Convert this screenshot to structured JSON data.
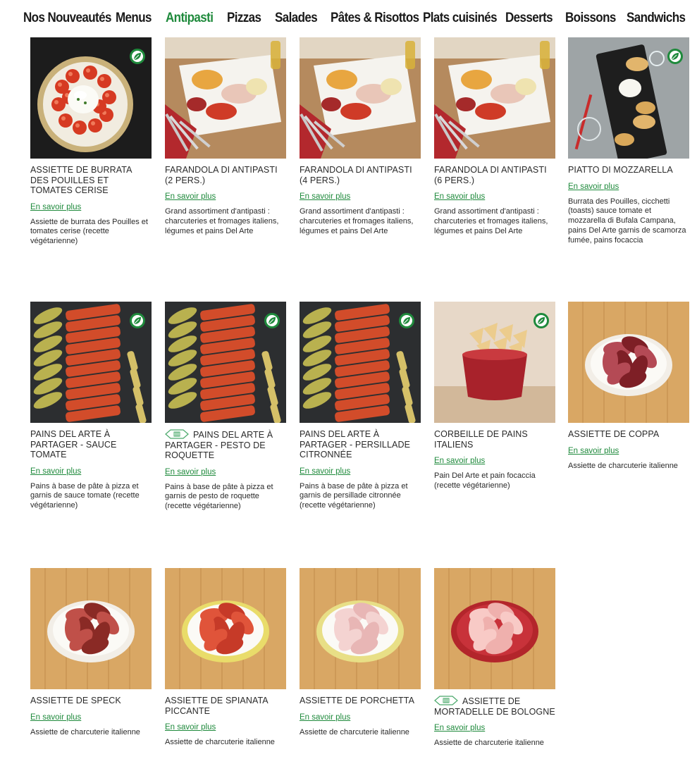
{
  "nav": {
    "items": [
      {
        "label": "Nos Nouveautés"
      },
      {
        "label": "Menus"
      },
      {
        "label": "Antipasti",
        "active": true
      },
      {
        "label": "Pizzas"
      },
      {
        "label": "Salades"
      },
      {
        "label": "Pâtes & Risottos"
      },
      {
        "label": "Plats cuisinés"
      },
      {
        "label": "Desserts"
      },
      {
        "label": "Boissons"
      },
      {
        "label": "Sandwichs"
      }
    ]
  },
  "colors": {
    "accent": "#1f8a3c",
    "text": "#2a2a2a"
  },
  "more_label": "En savoir plus",
  "products": [
    {
      "title": "ASSIETTE DE BURRATA DES POUILLES ET TOMATES CERISE",
      "desc": "Assiette de burrata des Pouilles et tomates cerise (recette végétarienne)",
      "veg": true,
      "image": "burrata-plate"
    },
    {
      "title": "FARANDOLA DI ANTIPASTI (2 PERS.)",
      "desc": "Grand assortiment d'antipasti : charcuteries et fromages italiens, légumes et pains Del Arte",
      "veg": false,
      "image": "antipasti-board"
    },
    {
      "title": "FARANDOLA DI ANTIPASTI (4 PERS.)",
      "desc": "Grand assortiment d'antipasti : charcuteries et fromages italiens, légumes et pains Del Arte",
      "veg": false,
      "image": "antipasti-board"
    },
    {
      "title": "FARANDOLA DI ANTIPASTI (6 PERS.)",
      "desc": "Grand assortiment d'antipasti : charcuteries et fromages italiens, légumes et pains Del Arte",
      "veg": false,
      "image": "antipasti-board"
    },
    {
      "title": "PIATTO DI MOZZARELLA",
      "desc": "Burrata des Pouilles, cicchetti (toasts) sauce tomate et mozzarella di Bufala Campana, pains Del Arte garnis de scamorza fumée, pains focaccia",
      "veg": true,
      "image": "mozzarella-slate"
    },
    {
      "title": "PAINS DEL ARTE À PARTAGER - SAUCE TOMATE",
      "desc": "Pains à base de pâte à pizza et garnis de sauce tomate (recette végétarienne)",
      "veg": true,
      "image": "bread-slate"
    },
    {
      "title": "PAINS DEL ARTE À PARTAGER - PESTO DE ROQUETTE",
      "desc": "Pains à base de pâte à pizza et garnis de pesto de roquette (recette végétarienne)",
      "veg": true,
      "image": "bread-slate",
      "label_icon": "origin-label-icon"
    },
    {
      "title": "PAINS DEL ARTE À PARTAGER - PERSILLADE CITRONNÉE",
      "desc": "Pains à base de pâte à pizza et garnis de persillade citronnée (recette végétarienne)",
      "veg": true,
      "image": "bread-slate"
    },
    {
      "title": "CORBEILLE DE PAINS ITALIENS",
      "desc": "Pain Del Arte et pain focaccia (recette végétarienne)",
      "veg": true,
      "image": "bread-basket"
    },
    {
      "title": "ASSIETTE DE COPPA",
      "desc": "Assiette de charcuterie italienne",
      "veg": false,
      "image": "coppa-plate"
    },
    {
      "title": "ASSIETTE DE SPECK",
      "desc": "Assiette de charcuterie italienne",
      "veg": false,
      "image": "speck-plate"
    },
    {
      "title": "ASSIETTE DE SPIANATA PICCANTE",
      "desc": "Assiette de charcuterie italienne",
      "veg": false,
      "image": "spianata-plate"
    },
    {
      "title": "ASSIETTE DE PORCHETTA",
      "desc": "Assiette de charcuterie italienne",
      "veg": false,
      "image": "porchetta-plate"
    },
    {
      "title": "ASSIETTE DE MORTADELLE DE BOLOGNE",
      "desc": "Assiette de charcuterie italienne",
      "veg": false,
      "image": "mortadella-plate",
      "label_icon": "origin-label-icon"
    }
  ]
}
